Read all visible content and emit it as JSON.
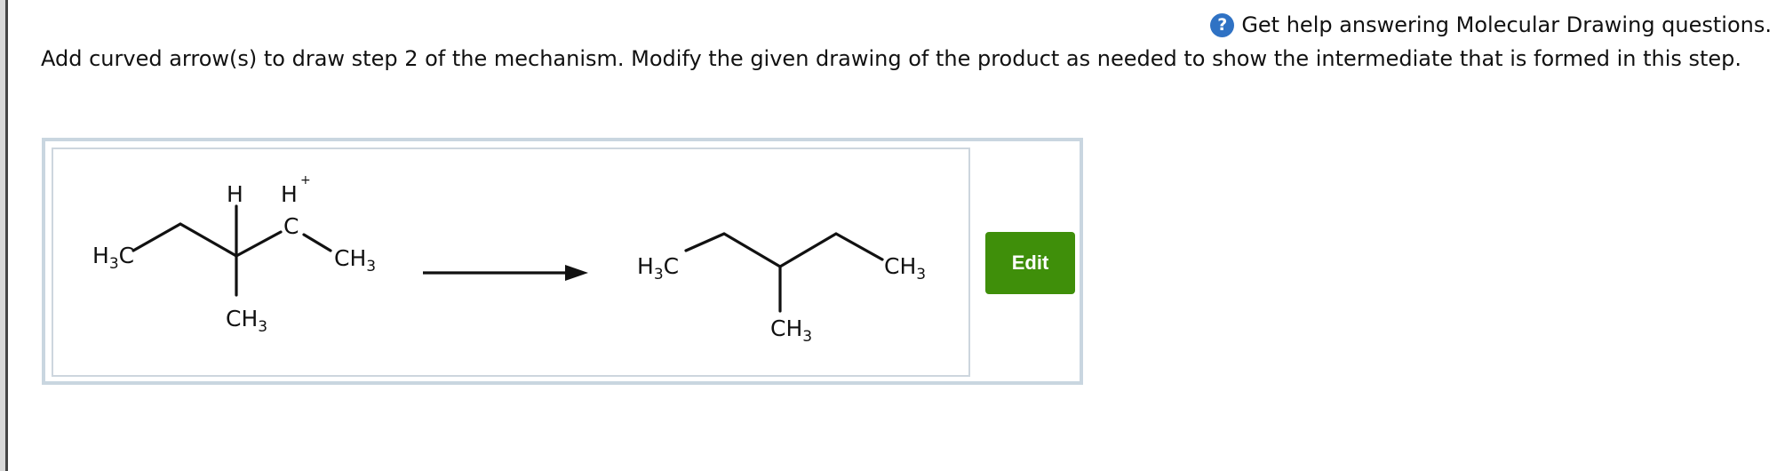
{
  "help": {
    "icon_glyph": "?",
    "text": "Get help answering Molecular Drawing questions."
  },
  "prompt": "Add curved arrow(s) to draw step 2 of the mechanism. Modify the given drawing of the product as needed to show the intermediate that is formed in this step.",
  "reactant": {
    "label_h3c": "H",
    "sub_3": "3",
    "label_c": "C",
    "label_ch": "CH",
    "label_h": "H",
    "label_plus": "+"
  },
  "product": {
    "label_h3c": "H",
    "sub_3": "3",
    "label_c": "C",
    "label_ch": "CH"
  },
  "edit_button": "Edit",
  "colors": {
    "edit_green": "#3f8f0a",
    "help_blue": "#2f72c4",
    "frame": "#c9d6e0"
  }
}
